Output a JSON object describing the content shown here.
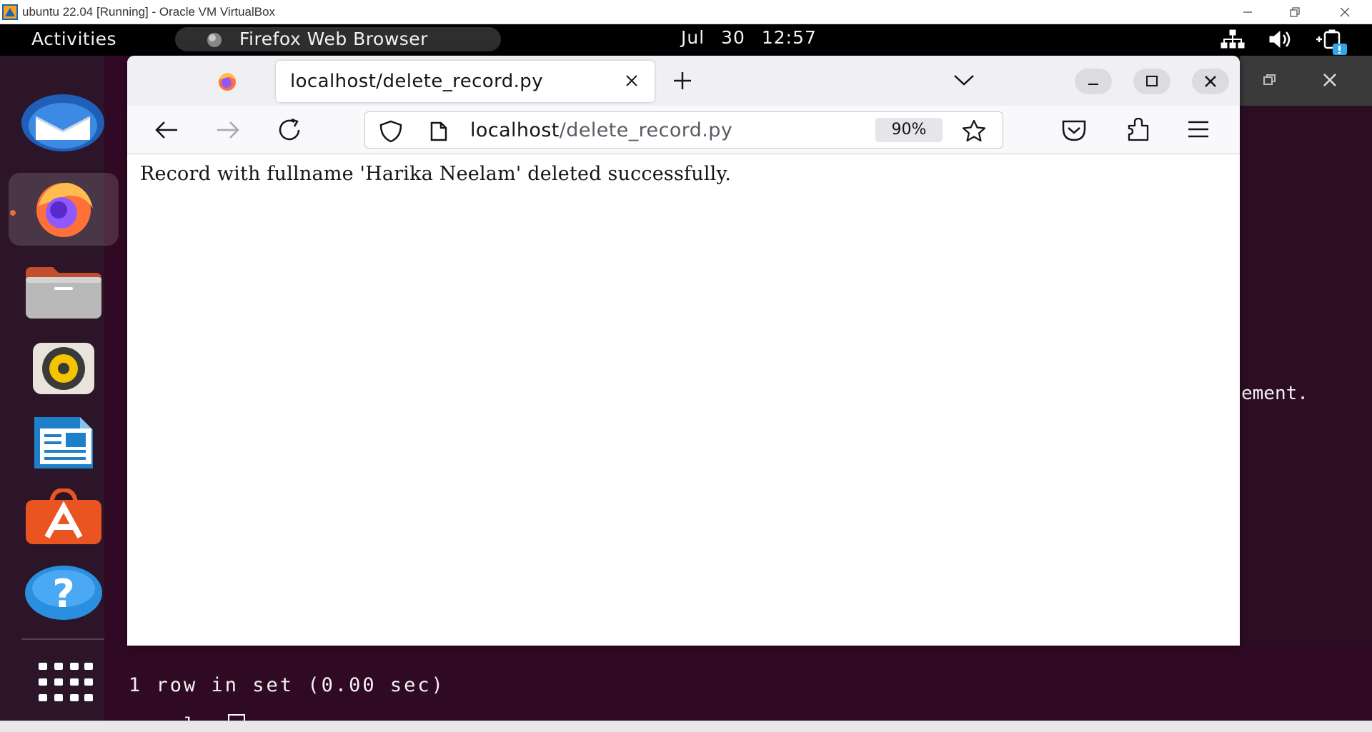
{
  "host": {
    "window_title": "ubuntu 22.04 [Running] - Oracle VM VirtualBox"
  },
  "topbar": {
    "activities": "Activities",
    "app_name": "Firefox Web Browser",
    "clock": "Jul 30  12:57"
  },
  "dock": {
    "items": [
      "Thunderbird Mail",
      "Firefox Web Browser",
      "Files",
      "Rhythmbox",
      "LibreOffice Writer",
      "Ubuntu Software",
      "Help",
      "Show Applications"
    ]
  },
  "firefox": {
    "tab_title": "localhost/delete_record.py",
    "url_host": "localhost",
    "url_path": "/delete_record.py",
    "zoom": "90%",
    "page_message": "Record with fullname 'Harika Neelam' deleted successfully."
  },
  "terminal": {
    "fragment": "ement.",
    "line1": "1 row in set (0.00 sec)",
    "prompt": "mysql>"
  },
  "colors": {
    "ubuntu_orange": "#e95420",
    "terminal_bg": "#300a24",
    "topbar_bg": "#000000"
  }
}
